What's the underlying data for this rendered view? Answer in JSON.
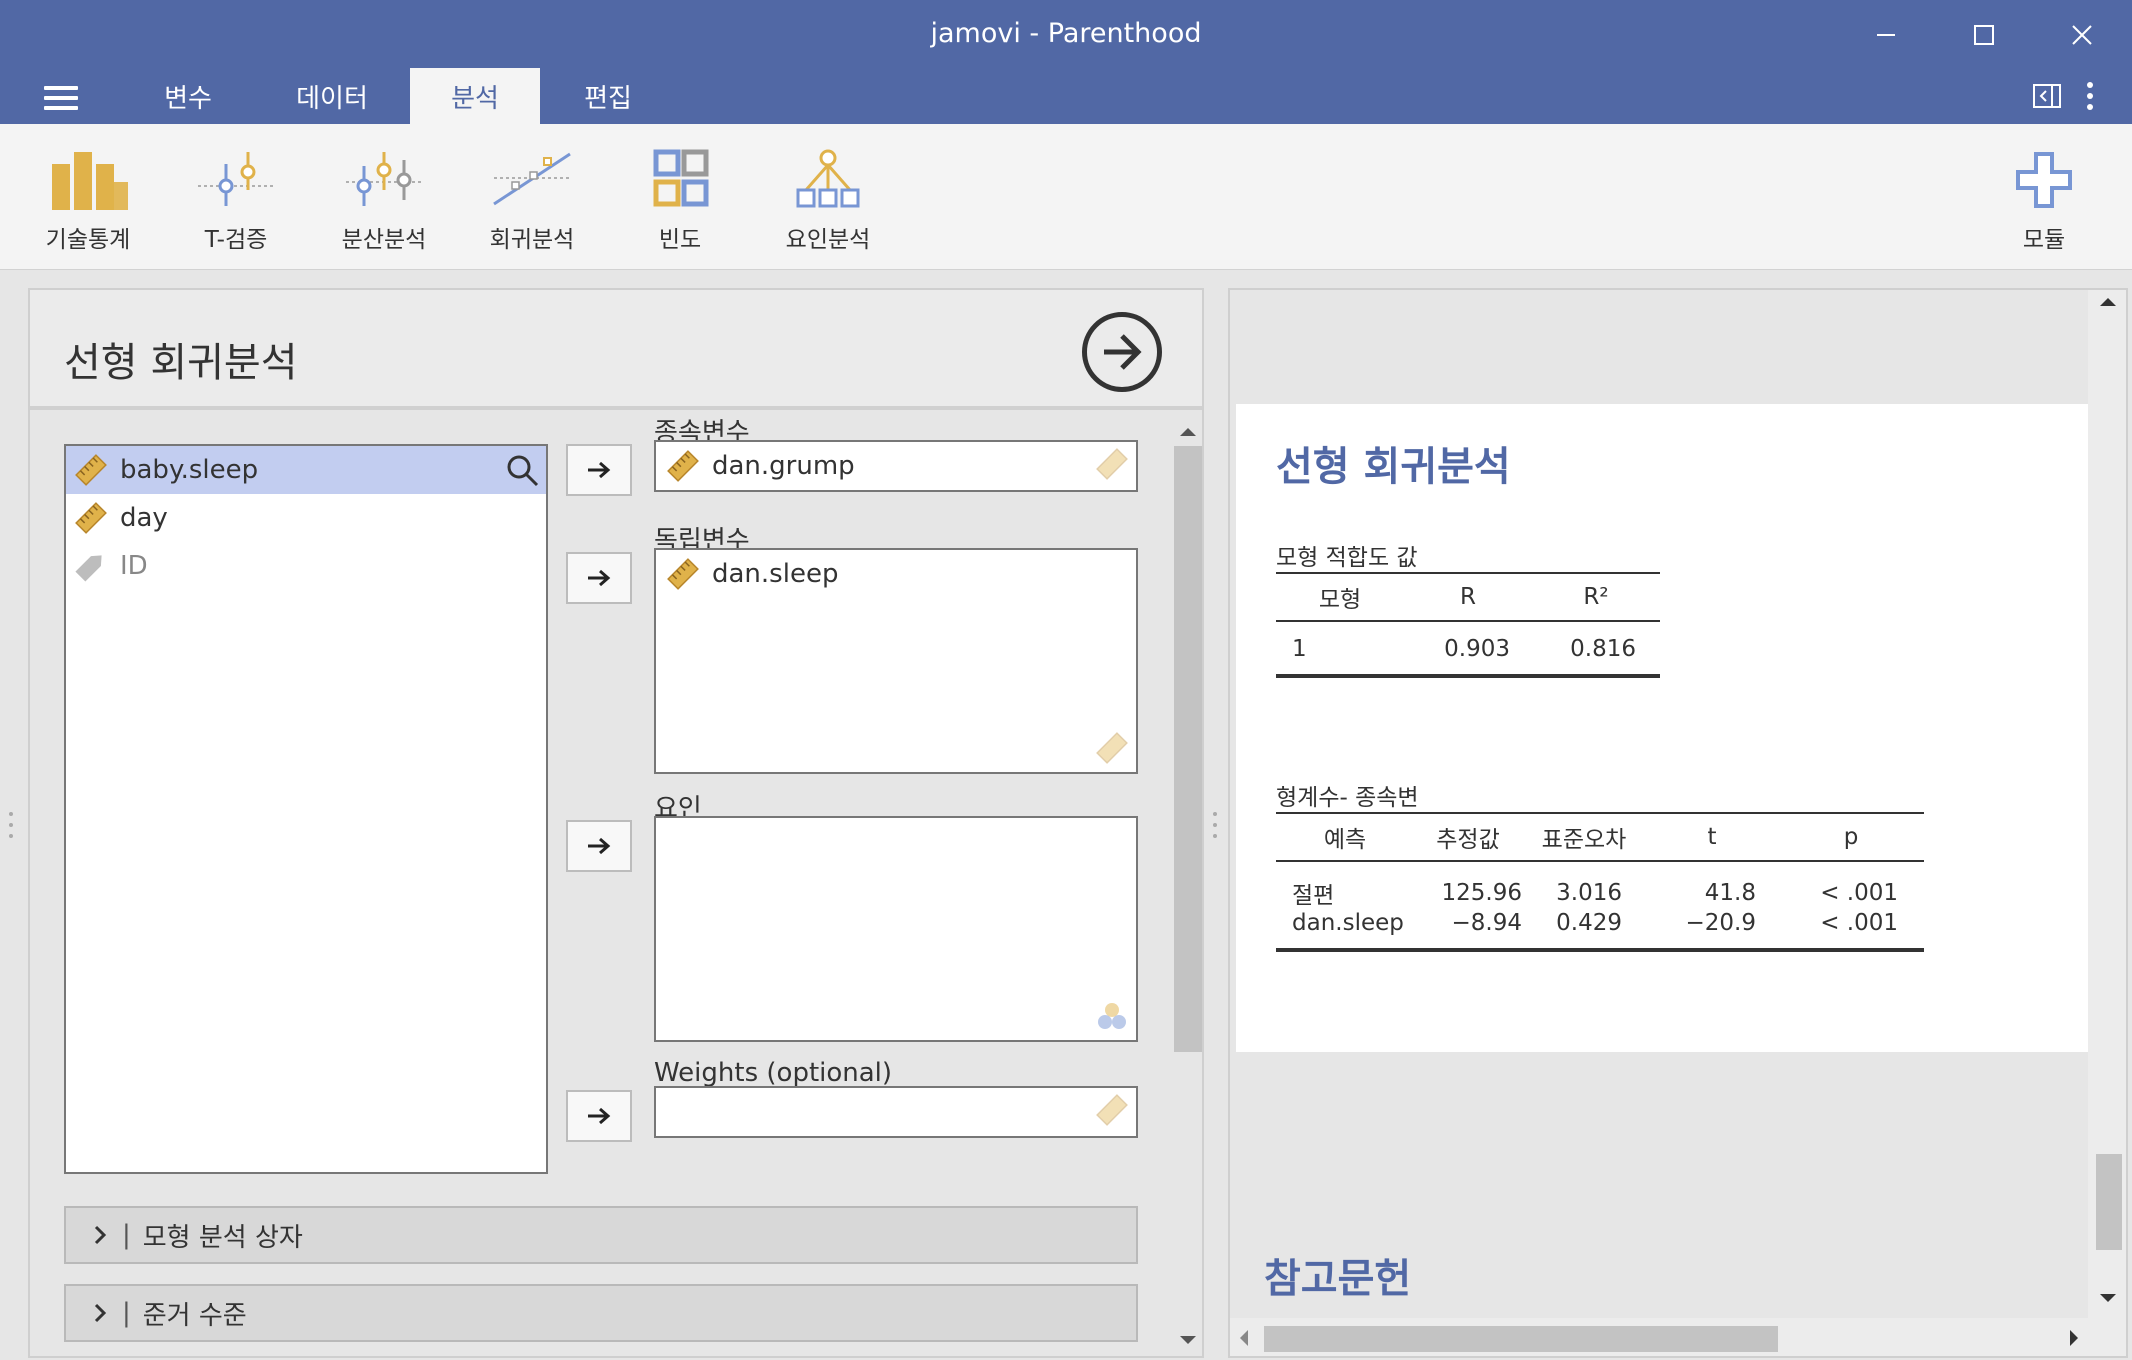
{
  "window": {
    "title": "jamovi - Parenthood",
    "minimize_icon": "minimize-icon",
    "maximize_icon": "maximize-icon",
    "close_icon": "close-icon"
  },
  "tabs": [
    {
      "label": "변수",
      "active": false
    },
    {
      "label": "데이터",
      "active": false
    },
    {
      "label": "분석",
      "active": true
    },
    {
      "label": "편집",
      "active": false
    }
  ],
  "ribbon": {
    "items": [
      {
        "label": "기술통계",
        "icon": "bar-chart-icon"
      },
      {
        "label": "T-검증",
        "icon": "ttest-icon"
      },
      {
        "label": "분산분석",
        "icon": "anova-icon"
      },
      {
        "label": "회귀분석",
        "icon": "regression-icon"
      },
      {
        "label": "빈도",
        "icon": "frequency-grid-icon"
      },
      {
        "label": "요인분석",
        "icon": "factor-tree-icon"
      }
    ],
    "modules_label": "모듈"
  },
  "options": {
    "heading": "선형 회귀분석",
    "variables": [
      {
        "name": "baby.sleep",
        "selected": true,
        "type": "continuous"
      },
      {
        "name": "day",
        "selected": false,
        "type": "continuous"
      },
      {
        "name": "ID",
        "selected": false,
        "type": "id"
      }
    ],
    "dependent": {
      "label": "종속변수",
      "value": "dan.grump"
    },
    "covariates": {
      "label": "독립변수",
      "items": [
        "dan.sleep"
      ]
    },
    "factors": {
      "label": "요인",
      "items": []
    },
    "weights": {
      "label": "Weights (optional)",
      "value": ""
    },
    "sections": [
      {
        "label": "모형 분석 상자"
      },
      {
        "label": "준거 수준"
      }
    ]
  },
  "results": {
    "title": "선형 회귀분석",
    "fit_table": {
      "title": "모형 적합도 값",
      "headers": [
        "모형",
        "R",
        "R²"
      ],
      "rows": [
        [
          "1",
          "0.903",
          "0.816"
        ]
      ]
    },
    "coef_table": {
      "title": "형계수- 종속변",
      "headers": [
        "예측",
        "추정값",
        "표준오차",
        "t",
        "p"
      ],
      "rows": [
        [
          "절편",
          "125.96",
          "3.016",
          "41.8",
          "< .001"
        ],
        [
          "dan.sleep",
          "−8.94",
          "0.429",
          "−20.9",
          "< .001"
        ]
      ]
    },
    "references_title": "참고문헌"
  },
  "colors": {
    "brand": "#5168a5",
    "selected_row": "#c2cdf0",
    "ruler_icon": "#e0b24a"
  }
}
